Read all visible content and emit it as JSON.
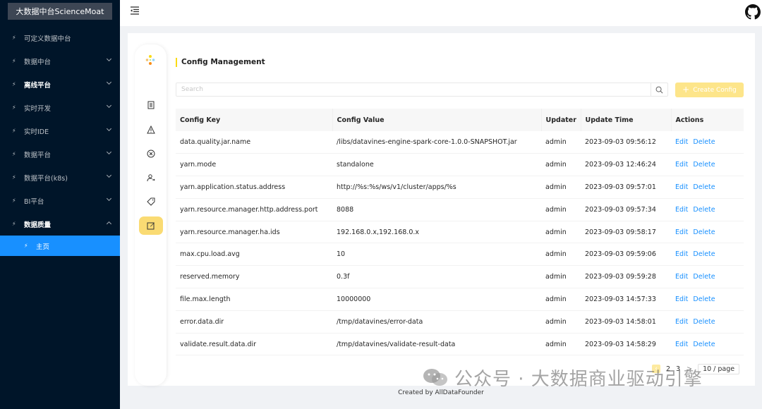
{
  "sidebar": {
    "title": "大数据中台ScienceMoat",
    "items": [
      {
        "label": "可定义数据中台",
        "chevron": "",
        "bold": false
      },
      {
        "label": "数据中台",
        "chevron": "down",
        "bold": false
      },
      {
        "label": "离线平台",
        "chevron": "down",
        "bold": true
      },
      {
        "label": "实时开发",
        "chevron": "down",
        "bold": false
      },
      {
        "label": "实时IDE",
        "chevron": "down",
        "bold": false
      },
      {
        "label": "数据平台",
        "chevron": "down",
        "bold": false
      },
      {
        "label": "数据平台(k8s)",
        "chevron": "down",
        "bold": false
      },
      {
        "label": "BI平台",
        "chevron": "down",
        "bold": false
      },
      {
        "label": "数据质量",
        "chevron": "up",
        "bold": true
      }
    ],
    "selected_item": "主页",
    "item_icon": "⚡"
  },
  "page": {
    "title": "Config Management",
    "search_placeholder": "Search",
    "create_label": "Create Config"
  },
  "table": {
    "headers": [
      "Config Key",
      "Config Value",
      "Updater",
      "Update Time",
      "Actions"
    ],
    "rows": [
      [
        "data.quality.jar.name",
        "/libs/datavines-engine-spark-core-1.0.0-SNAPSHOT.jar",
        "admin",
        "2023-09-03 09:56:12"
      ],
      [
        "yarn.mode",
        "standalone",
        "admin",
        "2023-09-03 12:46:24"
      ],
      [
        "yarn.application.status.address",
        "http://%s:%s/ws/v1/cluster/apps/%s",
        "admin",
        "2023-09-03 09:57:01"
      ],
      [
        "yarn.resource.manager.http.address.port",
        "8088",
        "admin",
        "2023-09-03 09:57:34"
      ],
      [
        "yarn.resource.manager.ha.ids",
        "192.168.0.x,192.168.0.x",
        "admin",
        "2023-09-03 09:58:17"
      ],
      [
        "max.cpu.load.avg",
        "10",
        "admin",
        "2023-09-03 09:59:06"
      ],
      [
        "reserved.memory",
        "0.3f",
        "admin",
        "2023-09-03 09:59:28"
      ],
      [
        "file.max.length",
        "10000000",
        "admin",
        "2023-09-03 14:57:33"
      ],
      [
        "error.data.dir",
        "/tmp/datavines/error-data",
        "admin",
        "2023-09-03 14:58:01"
      ],
      [
        "validate.result.data.dir",
        "/tmp/datavines/validate-result-data",
        "admin",
        "2023-09-03 14:58:29"
      ]
    ],
    "edit_label": "Edit",
    "delete_label": "Delete"
  },
  "pagination": {
    "pages": [
      "2",
      "3"
    ],
    "next": ">",
    "page_size": "10 / page"
  },
  "footer": "Created by AllDataFounder",
  "watermark": "公众号 · 大数据商业驱动引擎",
  "colors": {
    "sidebar_bg": "#001529",
    "selected": "#1890ff",
    "accent_yellow": "#fadb73",
    "link": "#1890ff"
  }
}
